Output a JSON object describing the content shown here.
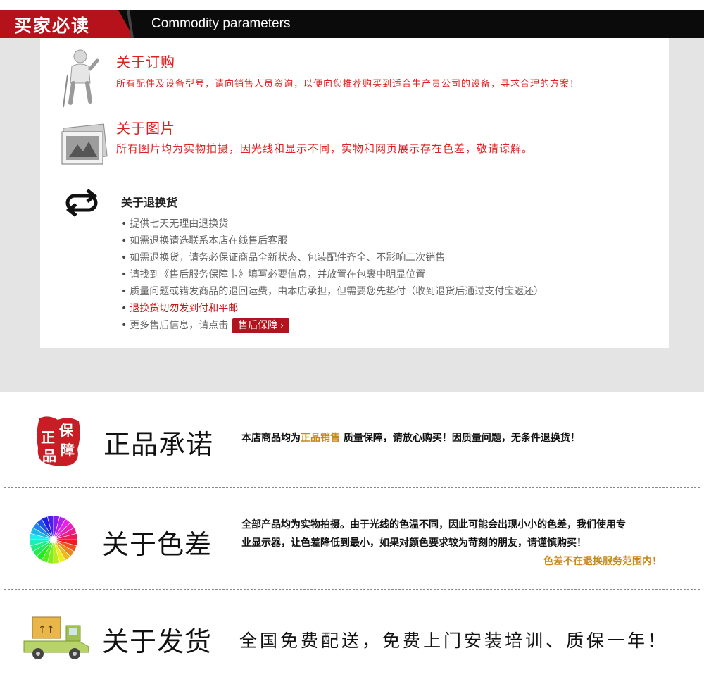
{
  "header": {
    "title_cn": "买家必读",
    "title_en": "Commodity parameters"
  },
  "ordering": {
    "title": "关于订购",
    "text": "所有配件及设备型号，请向销售人员资询，以便向您推荐购买到适合生产贵公司的设备，寻求合理的方案！",
    "icon": "figure-icon"
  },
  "pictures": {
    "title": "关于图片",
    "text": "所有图片均为实物拍摄，因光线和显示不同，实物和网页展示存在色差，敬请谅解。",
    "icon": "photo-icon"
  },
  "returns": {
    "title": "关于退换货",
    "icon": "return-arrows-icon",
    "items": [
      "提供七天无理由退换货",
      "如需退换请选联系本店在线售后客服",
      "如需退换货，请务必保证商品全新状态、包装配件齐全、不影响二次销售",
      "请找到《售后服务保障卡》填写必要信息，并放置在包裹中明显位置",
      "质量问题或错发商品的退回运费，由本店承担，但需要您先垫付（收到退货后通过支付宝返还）",
      "退换货切勿发到付和平邮"
    ],
    "more_text": "更多售后信息，请点击",
    "button_label": "售后保障",
    "button_chevron": "›"
  },
  "genuine": {
    "seal_chars": [
      "正",
      "保",
      "品",
      "障"
    ],
    "title": "正品承诺",
    "text_before": "本店商品均为",
    "text_highlight": "正品销售",
    "text_after": "质量保障，请放心购买！因质量问题，无条件退换货！"
  },
  "color": {
    "title": "关于色差",
    "line1": "全部产品均为实物拍摄。由于光线的色温不同，因此可能会出现小小的色差，我们使用专",
    "line2": "业显示器，让色差降低到最小，如果对颜色要求较为苛刻的朋友，请谨慎购买！",
    "note": "色差不在退换服务范围内！"
  },
  "shipping": {
    "title": "关于发货",
    "text": "全国免费配送，免费上门安装培训、质保一年！"
  },
  "colors": {
    "brand_red": "#b5121b",
    "text_red": "#e02020",
    "highlight_orange": "#c9871b"
  }
}
